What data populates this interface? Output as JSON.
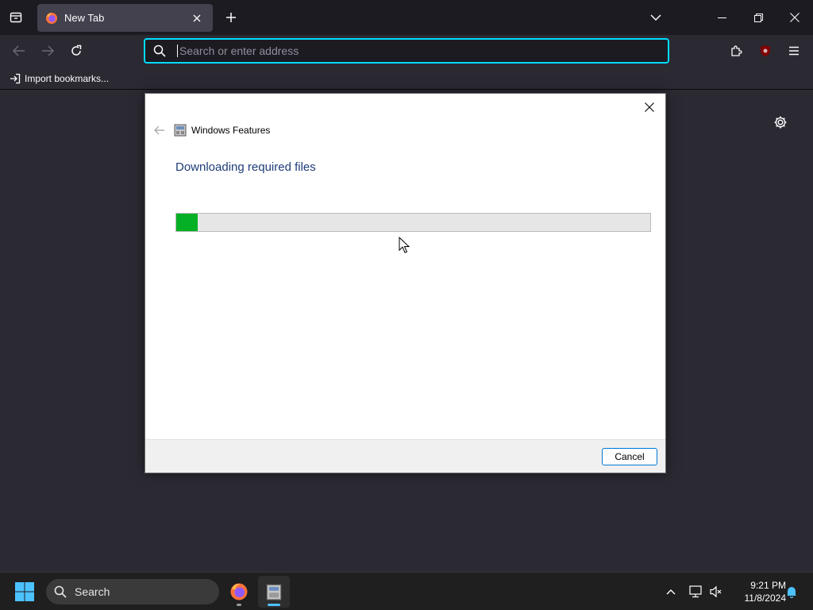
{
  "browser": {
    "tab": {
      "title": "New Tab"
    },
    "urlbar": {
      "placeholder": "Search or enter address"
    },
    "bookmarks": {
      "import_label": "Import bookmarks..."
    }
  },
  "dialog": {
    "title": "Windows Features",
    "heading": "Downloading required files",
    "progress": 0.045,
    "cancel_label": "Cancel"
  },
  "taskbar": {
    "search_label": "Search",
    "time": "9:21 PM",
    "date": "11/8/2024"
  },
  "colors": {
    "accent": "#00ddff",
    "progress_fill": "#06b025",
    "heading": "#1e3d78"
  }
}
